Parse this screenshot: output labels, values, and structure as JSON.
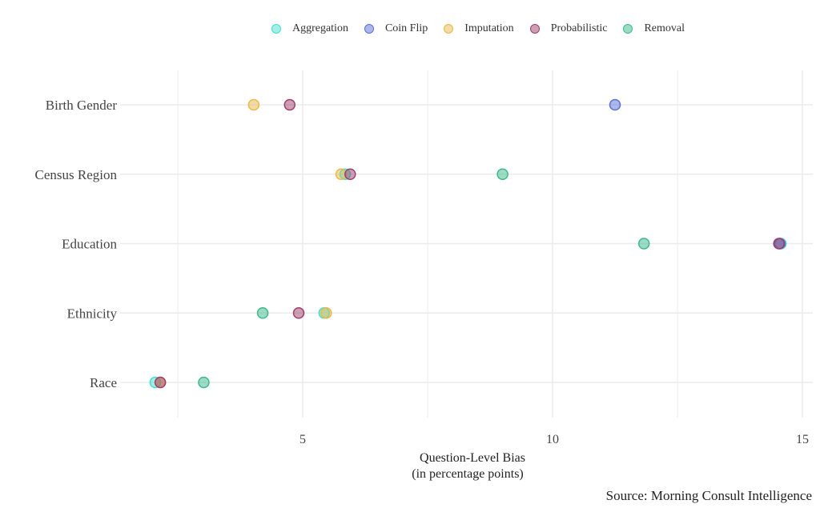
{
  "chart_data": {
    "type": "scatter",
    "orientation": "horizontal-dot-plot",
    "title": "",
    "xlabel": "Question-Level Bias",
    "xlabel_line2": "(in percentage points)",
    "ylabel": "",
    "caption": "Source: Morning Consult Intelligence",
    "xlim": [
      1.5,
      15.2
    ],
    "xticks": [
      5,
      10,
      15
    ],
    "xtick_labels": [
      "5",
      "10",
      "15"
    ],
    "grid": true,
    "legend_position": "top",
    "categories": [
      "Birth Gender",
      "Census Region",
      "Education",
      "Ethnicity",
      "Race"
    ],
    "series": [
      {
        "name": "Aggregation",
        "color": "#40E0D0",
        "values": [
          null,
          5.85,
          14.57,
          5.43,
          2.05
        ]
      },
      {
        "name": "Coin Flip",
        "color": "#5B6FD8",
        "values": [
          11.25,
          null,
          14.55,
          null,
          null
        ]
      },
      {
        "name": "Imputation",
        "color": "#E8B84A",
        "values": [
          4.02,
          5.77,
          null,
          5.47,
          2.15
        ]
      },
      {
        "name": "Probabilistic",
        "color": "#9E3D6B",
        "values": [
          4.74,
          5.95,
          14.53,
          4.92,
          2.15
        ]
      },
      {
        "name": "Removal",
        "color": "#3CB98A",
        "values": [
          null,
          9.0,
          11.83,
          4.2,
          3.02
        ]
      }
    ]
  }
}
